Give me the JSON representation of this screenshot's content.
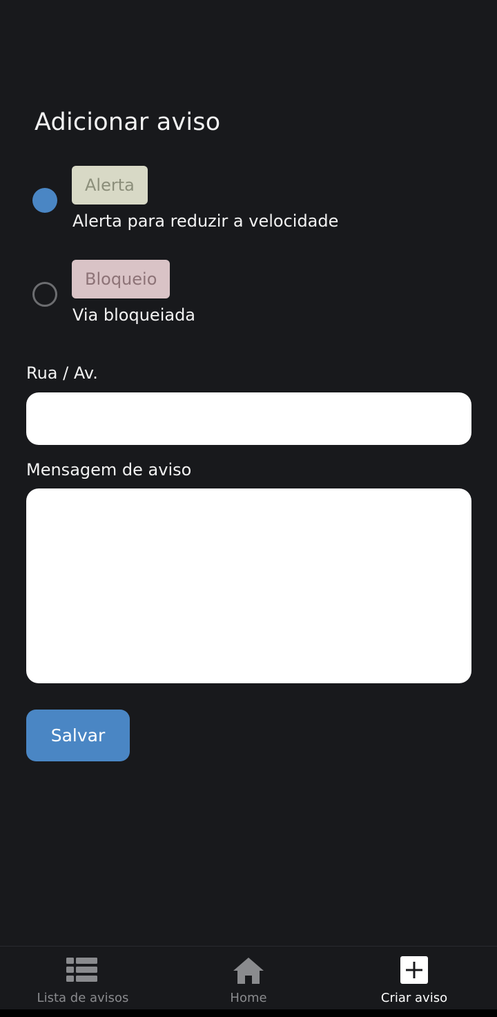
{
  "page": {
    "title": "Adicionar aviso"
  },
  "options": [
    {
      "tag": "Alerta",
      "description": "Alerta para reduzir a velocidade",
      "selected": true
    },
    {
      "tag": "Bloqueio",
      "description": "Via bloqueiada",
      "selected": false
    }
  ],
  "form": {
    "street_label": "Rua / Av.",
    "street_value": "",
    "message_label": "Mensagem de aviso",
    "message_value": "",
    "save_label": "Salvar"
  },
  "bottom_nav": {
    "items": [
      {
        "label": "Lista de avisos",
        "icon": "list-icon",
        "active": false
      },
      {
        "label": "Home",
        "icon": "home-icon",
        "active": false
      },
      {
        "label": "Criar aviso",
        "icon": "add-box-icon",
        "active": true
      }
    ]
  },
  "colors": {
    "background": "#18191c",
    "accent": "#4a86c4",
    "alerta_tag": "#d8d9c6",
    "bloqueio_tag": "#d9c3c6",
    "nav_inactive": "#8a8b8e",
    "nav_active": "#ffffff"
  }
}
